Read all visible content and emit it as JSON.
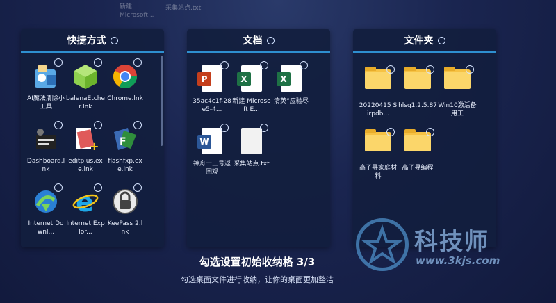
{
  "ghost": {
    "line1": "新建",
    "line2": "Microsoft...",
    "file": "采集站点.txt"
  },
  "panels": [
    {
      "title": "快捷方式",
      "items": [
        {
          "label": "AI魔法清除小工具",
          "icon": "ai-eraser-icon"
        },
        {
          "label": "balenaEtcher.lnk",
          "icon": "balena-etcher-icon"
        },
        {
          "label": "Chrome.lnk",
          "icon": "chrome-icon"
        },
        {
          "label": "Dashboard.lnk",
          "icon": "dashboard-icon"
        },
        {
          "label": "editplus.exe.lnk",
          "icon": "editplus-icon"
        },
        {
          "label": "flashfxp.exe.lnk",
          "icon": "flashfxp-icon"
        },
        {
          "label": "Internet Downl...",
          "icon": "internet-download-icon"
        },
        {
          "label": "Internet Explor...",
          "icon": "internet-explorer-icon"
        },
        {
          "label": "KeePass 2.lnk",
          "icon": "keepass-icon"
        }
      ]
    },
    {
      "title": "文档",
      "items": [
        {
          "label": "35ac4c1f-28e5-4...",
          "icon": "powerpoint-icon"
        },
        {
          "label": "新建 Microsoft E...",
          "icon": "excel-icon"
        },
        {
          "label": "清英“应验尽",
          "icon": "excel-icon"
        },
        {
          "label": "神舟十三号返回观",
          "icon": "word-icon"
        },
        {
          "label": "采集站点.txt",
          "icon": "text-file-icon"
        }
      ]
    },
    {
      "title": "文件夹",
      "items": [
        {
          "label": "20220415 Sirpdb...",
          "icon": "folder-icon"
        },
        {
          "label": "hlsq1.2.5.87",
          "icon": "folder-icon"
        },
        {
          "label": "Win10激活备用工",
          "icon": "folder-icon"
        },
        {
          "label": "高子寻家庭材料",
          "icon": "folder-icon"
        },
        {
          "label": "高子寻编程",
          "icon": "folder-icon"
        }
      ]
    }
  ],
  "footer": {
    "title": "勾选设置初始收纳格 3/3",
    "subtitle": "勾选桌面文件进行收纳，让你的桌面更加整洁"
  },
  "watermark": {
    "title": "科技师",
    "url": "www.3kjs.com"
  },
  "colors": {
    "accent": "#2e8fd0",
    "folder": "#f6c244",
    "word": "#2b5797",
    "excel": "#1e7145",
    "powerpoint": "#c43e1c"
  }
}
